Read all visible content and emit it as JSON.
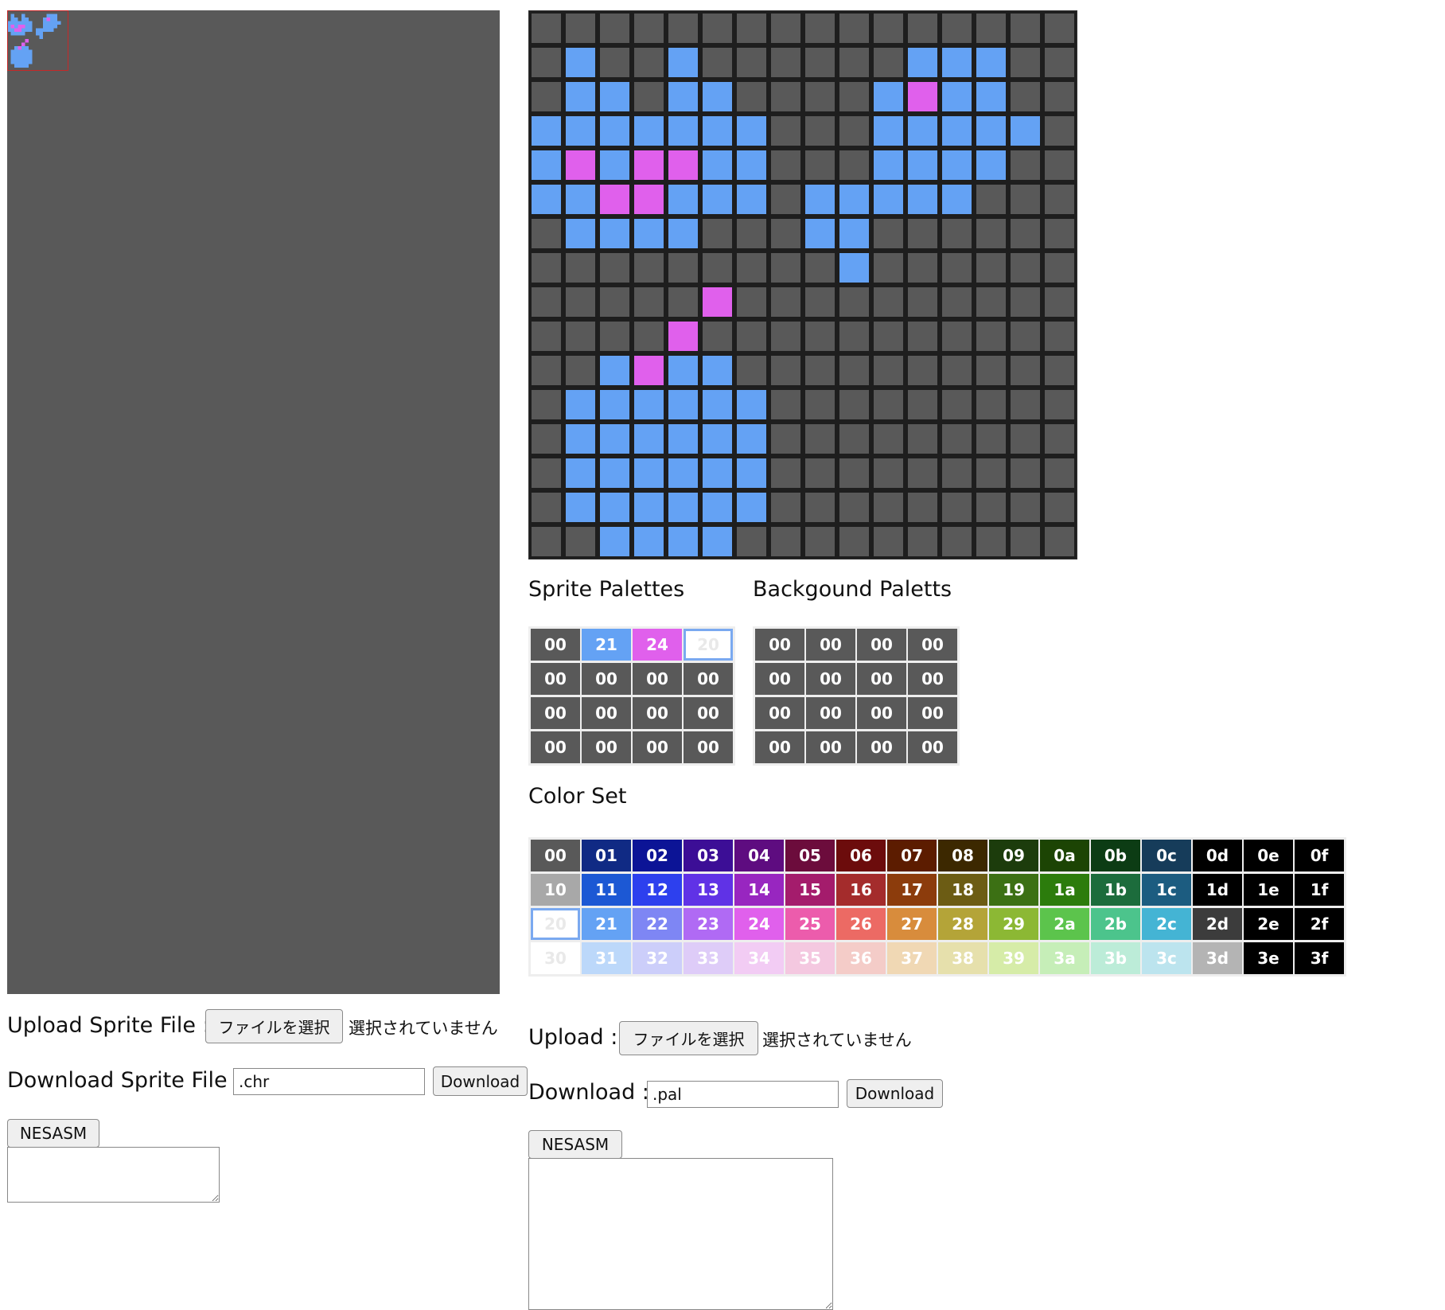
{
  "sprite_sheet": {
    "selected_tile": 0,
    "thumbnail_rows": [
      "0000000000000000",
      "0100100000011100",
      "0110110000121100",
      "1111111000111110",
      "1212211000111100",
      "1122111011111000",
      "0111100011000000",
      "0000000001000000",
      "0000020000000000",
      "0000200000000000",
      "0012110000000000",
      "0111111000000000",
      "0111111000000000",
      "0111111000000000",
      "0111111000000000",
      "0011110000000000"
    ]
  },
  "editor": {
    "pixel_rows": [
      "0000000000000000",
      "0100100000011100",
      "0110110000121100",
      "1111111000111110",
      "1212211000111100",
      "1122111011111000",
      "0111100011000000",
      "0000000001000000",
      "0000020000000000",
      "0000200000000000",
      "0012110000000000",
      "0111111000000000",
      "0111111000000000",
      "0111111000000000",
      "0111111000000000",
      "0011110000000000"
    ],
    "colors": {
      "0": "#595959",
      "1": "#64a2f4",
      "2": "#e060ec",
      "3": "#ffffff"
    }
  },
  "sprite_palettes": {
    "title": "Sprite Palettes",
    "rows": [
      [
        "00",
        "21",
        "24",
        "20"
      ],
      [
        "00",
        "00",
        "00",
        "00"
      ],
      [
        "00",
        "00",
        "00",
        "00"
      ],
      [
        "00",
        "00",
        "00",
        "00"
      ]
    ],
    "selected": [
      0,
      3
    ]
  },
  "background_palettes": {
    "title": "Backgound Paletts",
    "rows": [
      [
        "00",
        "00",
        "00",
        "00"
      ],
      [
        "00",
        "00",
        "00",
        "00"
      ],
      [
        "00",
        "00",
        "00",
        "00"
      ],
      [
        "00",
        "00",
        "00",
        "00"
      ]
    ]
  },
  "color_set": {
    "title": "Color Set",
    "selected": "20",
    "rows": [
      [
        "00",
        "01",
        "02",
        "03",
        "04",
        "05",
        "06",
        "07",
        "08",
        "09",
        "0a",
        "0b",
        "0c",
        "0d",
        "0e",
        "0f"
      ],
      [
        "10",
        "11",
        "12",
        "13",
        "14",
        "15",
        "16",
        "17",
        "18",
        "19",
        "1a",
        "1b",
        "1c",
        "1d",
        "1e",
        "1f"
      ],
      [
        "20",
        "21",
        "22",
        "23",
        "24",
        "25",
        "26",
        "27",
        "28",
        "29",
        "2a",
        "2b",
        "2c",
        "2d",
        "2e",
        "2f"
      ],
      [
        "30",
        "31",
        "32",
        "33",
        "34",
        "35",
        "36",
        "37",
        "38",
        "39",
        "3a",
        "3b",
        "3c",
        "3d",
        "3e",
        "3f"
      ]
    ],
    "colors": {
      "00": "#595959",
      "01": "#102a84",
      "02": "#0c1496",
      "03": "#3c0e96",
      "04": "#5e0c80",
      "05": "#6c0c3c",
      "06": "#6c0c0c",
      "07": "#5c1c00",
      "08": "#3c2800",
      "09": "#1c3c0c",
      "0a": "#1c4404",
      "0b": "#0c3c14",
      "0c": "#163c5a",
      "0d": "#000000",
      "0e": "#000000",
      "0f": "#000000",
      "10": "#a8a8a8",
      "11": "#1c58d4",
      "12": "#2d40ee",
      "13": "#6032e6",
      "14": "#9826c0",
      "15": "#a41c6c",
      "16": "#a42c2c",
      "17": "#8c3c0c",
      "18": "#6c5c14",
      "19": "#3c7014",
      "1a": "#2c7c0c",
      "1b": "#1c6c3c",
      "1c": "#1c5c80",
      "1d": "#000000",
      "1e": "#000000",
      "1f": "#000000",
      "20": "#ffffff",
      "21": "#64a2f4",
      "22": "#7e86f4",
      "23": "#b06af4",
      "24": "#e060ec",
      "25": "#ec5cac",
      "26": "#ec6a64",
      "27": "#d88c3c",
      "28": "#b4a438",
      "29": "#8cb834",
      "2a": "#5cc44c",
      "2b": "#4cc48c",
      "2c": "#44b4d4",
      "2d": "#3c3c3c",
      "2e": "#000000",
      "2f": "#000000",
      "30": "#ffffff",
      "31": "#bcd8fa",
      "32": "#cccefa",
      "33": "#deccf8",
      "34": "#f2ccf4",
      "35": "#f4c8e0",
      "36": "#f4ccc8",
      "37": "#f0d8b4",
      "38": "#e6e0ac",
      "39": "#d6eca8",
      "3a": "#c6eeb8",
      "3b": "#bcecd8",
      "3c": "#bce4ee",
      "3d": "#b4b4b4",
      "3e": "#000000",
      "3f": "#000000"
    }
  },
  "left_panel": {
    "upload_label": "Upload Sprite File :",
    "file_button": "ファイルを選択",
    "no_file": "選択されていません",
    "download_label": "Download Sprite File :",
    "download_value": ".chr",
    "download_button": "Download",
    "nesasm_button": "NESASM",
    "nesasm_output": ""
  },
  "right_panel": {
    "upload_label": "Upload :",
    "file_button": "ファイルを選択",
    "no_file": "選択されていません",
    "download_label": "Download :",
    "download_value": ".pal",
    "download_button": "Download",
    "nesasm_button": "NESASM",
    "nesasm_output": ""
  }
}
